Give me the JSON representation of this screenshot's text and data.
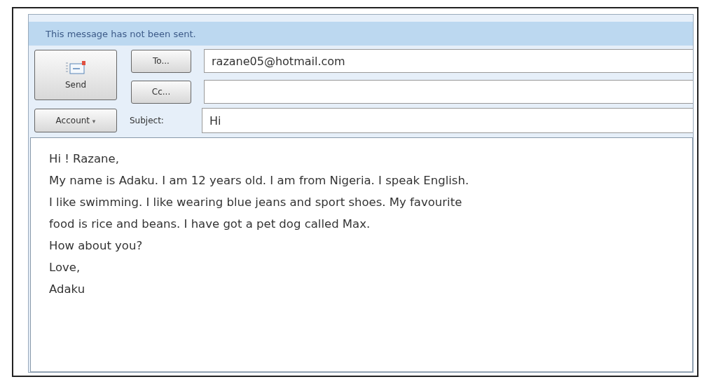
{
  "info_bar": {
    "text": "This message has not been sent."
  },
  "send_button": {
    "label": "Send"
  },
  "recipients": [
    {
      "button": "To...",
      "value": "razane05@hotmail.com"
    },
    {
      "button": "Cc..."
    }
  ],
  "account_button": {
    "label": "Account",
    "caret": "▾"
  },
  "subject": {
    "label": "Subject:",
    "value": "Hi"
  },
  "body_lines": [
    "Hi ! Razane,",
    "My name is Adaku. I am 12 years old. I am from Nigeria. I speak English.",
    "I like swimming. I like wearing blue jeans and sport shoes. My favourite",
    "food is rice and beans. I have got a pet dog called Max.",
    "How about you?",
    "Love,",
    "Adaku"
  ]
}
